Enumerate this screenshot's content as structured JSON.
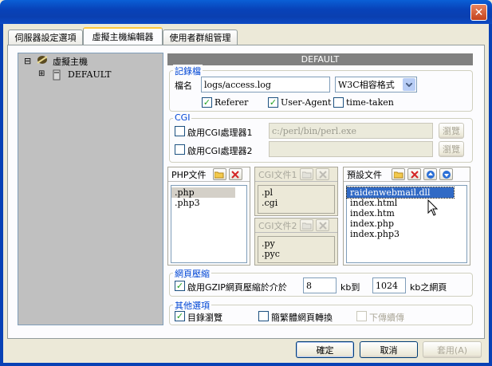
{
  "tabs": [
    "伺服器設定選項",
    "虛擬主機編輯器",
    "使用者群組管理"
  ],
  "close_glyph": "✕",
  "tree": {
    "root": "虛擬主機",
    "child": "DEFAULT",
    "root_toggle": "⊟",
    "child_toggle": "⊞"
  },
  "header": "DEFAULT",
  "log": {
    "label": "記錄檔",
    "name_label": "檔名",
    "file": "logs/access.log",
    "format": "W3C相容格式",
    "opt_referer": "Referer",
    "opt_useragent": "User-Agent",
    "opt_timetaken": "time-taken",
    "referer_checked": true,
    "useragent_checked": true,
    "timetaken_checked": false
  },
  "cgi": {
    "label": "CGI",
    "enable1": "啟用CGI處理器1",
    "path1": "c:/perl/bin/perl.exe",
    "enable2": "啟用CGI處理器2",
    "path2": "",
    "browse": "瀏覽"
  },
  "php_panel": {
    "title": "PHP文件",
    "items": [
      ".php",
      ".php3"
    ]
  },
  "cgi1_panel": {
    "title": "CGI文件1",
    "items": [
      ".pl",
      ".cgi"
    ]
  },
  "cgi2_panel": {
    "title": "CGI文件2",
    "items": [
      ".py",
      ".pyc"
    ]
  },
  "default_panel": {
    "title": "預設文件",
    "items": [
      "raidenwebmail.dll",
      "index.html",
      "index.htm",
      "index.php",
      "index.php3"
    ]
  },
  "gzip": {
    "label": "網頁壓縮",
    "enable": "啟用GZIP網頁壓縮於介於",
    "min": "8",
    "mid": "kb到",
    "max": "1024",
    "end": "kb之網頁",
    "checked": true
  },
  "other": {
    "label": "其他選項",
    "dir_browse": "目錄瀏覽",
    "conv": "簡繁體網頁轉換",
    "resume": "下傳續傳",
    "dir_checked": true,
    "conv_checked": false
  },
  "buttons": {
    "ok": "確定",
    "cancel": "取消",
    "apply": "套用(A)"
  },
  "colors": {
    "titlebar": "#0a3fb0",
    "selection": "#316ac5",
    "group_label": "#0046d5",
    "check": "#21a121"
  }
}
